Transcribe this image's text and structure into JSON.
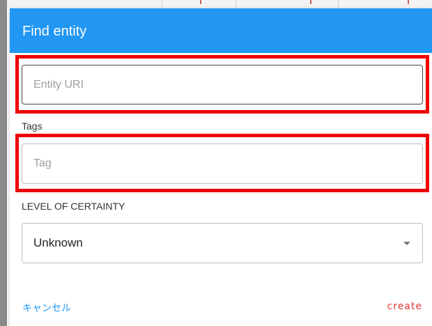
{
  "dialog": {
    "title": "Find entity",
    "header_color": "#2196f3",
    "highlight_color": "#ee0000"
  },
  "fields": {
    "entity_uri": {
      "placeholder": "Entity URI",
      "value": ""
    },
    "tags": {
      "label": "Tags",
      "placeholder": "Tag",
      "value": ""
    },
    "level_of_certainty": {
      "label": "LEVEL OF CERTAINTY",
      "selected": "Unknown",
      "icon": "caret-down-icon"
    }
  },
  "actions": {
    "cancel_label": "キャンセル",
    "create_label": "create",
    "cancel_color": "#2196f3",
    "create_color": "#e53935"
  }
}
